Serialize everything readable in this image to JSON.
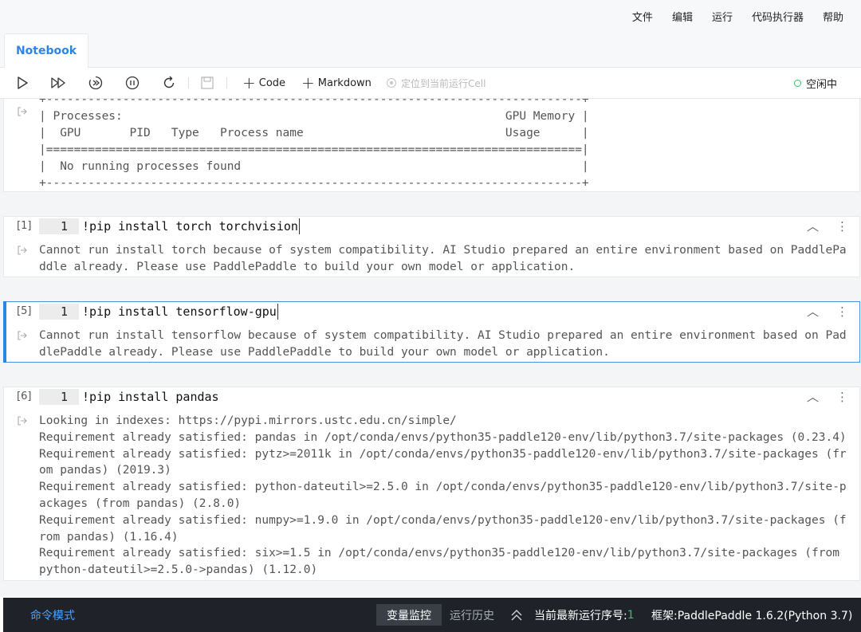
{
  "menu": [
    "文件",
    "编辑",
    "运行",
    "代码执行器",
    "帮助"
  ],
  "tab": {
    "label": "Notebook"
  },
  "toolbar": {
    "code_label": "Code",
    "markdown_label": "Markdown",
    "locate_label": "定位到当前运行Cell",
    "status_label": "空闲中",
    "icons": [
      "run-icon",
      "run-all-icon",
      "run-below-icon",
      "interrupt-icon",
      "restart-icon",
      "save-icon",
      "plus-icon",
      "target-icon"
    ]
  },
  "cells": [
    {
      "output": "+-----------------------------------------------------------------------------+\n| Processes:                                                       GPU Memory |\n|  GPU       PID   Type   Process name                             Usage      |\n|=============================================================================|\n|  No running processes found                                                 |\n+-----------------------------------------------------------------------------+"
    },
    {
      "exec_count": "[1]",
      "line_number": "1",
      "code": "!pip install torch torchvision",
      "output": "Cannot run install torch because of system compatibility. AI Studio prepared an entire environment based on PaddlePaddle already. Please use PaddlePaddle to build your own model or application."
    },
    {
      "exec_count": "[5]",
      "line_number": "1",
      "code": "!pip install tensorflow-gpu",
      "output": "Cannot run install tensorflow because of system compatibility. AI Studio prepared an entire environment based on PaddlePaddle already. Please use PaddlePaddle to build your own model or application."
    },
    {
      "exec_count": "[6]",
      "line_number": "1",
      "code": "!pip install pandas",
      "output": "Looking in indexes: https://pypi.mirrors.ustc.edu.cn/simple/\nRequirement already satisfied: pandas in /opt/conda/envs/python35-paddle120-env/lib/python3.7/site-packages (0.23.4)\nRequirement already satisfied: pytz>=2011k in /opt/conda/envs/python35-paddle120-env/lib/python3.7/site-packages (from pandas) (2019.3)\nRequirement already satisfied: python-dateutil>=2.5.0 in /opt/conda/envs/python35-paddle120-env/lib/python3.7/site-packages (from pandas) (2.8.0)\nRequirement already satisfied: numpy>=1.9.0 in /opt/conda/envs/python35-paddle120-env/lib/python3.7/site-packages (from pandas) (1.16.4)\nRequirement already satisfied: six>=1.5 in /opt/conda/envs/python35-paddle120-env/lib/python3.7/site-packages (from python-dateutil>=2.5.0->pandas) (1.12.0)"
    }
  ],
  "bottombar": {
    "mode": "命令模式",
    "var_monitor": "变量监控",
    "run_history": "运行历史",
    "seq_label": "当前最新运行序号:",
    "seq_value": "1",
    "framework": "框架:PaddlePaddle 1.6.2(Python 3.7)"
  },
  "colors": {
    "accent": "#2b86e3",
    "status_ok": "#34c36b",
    "bottom_bg": "#1f2329"
  }
}
